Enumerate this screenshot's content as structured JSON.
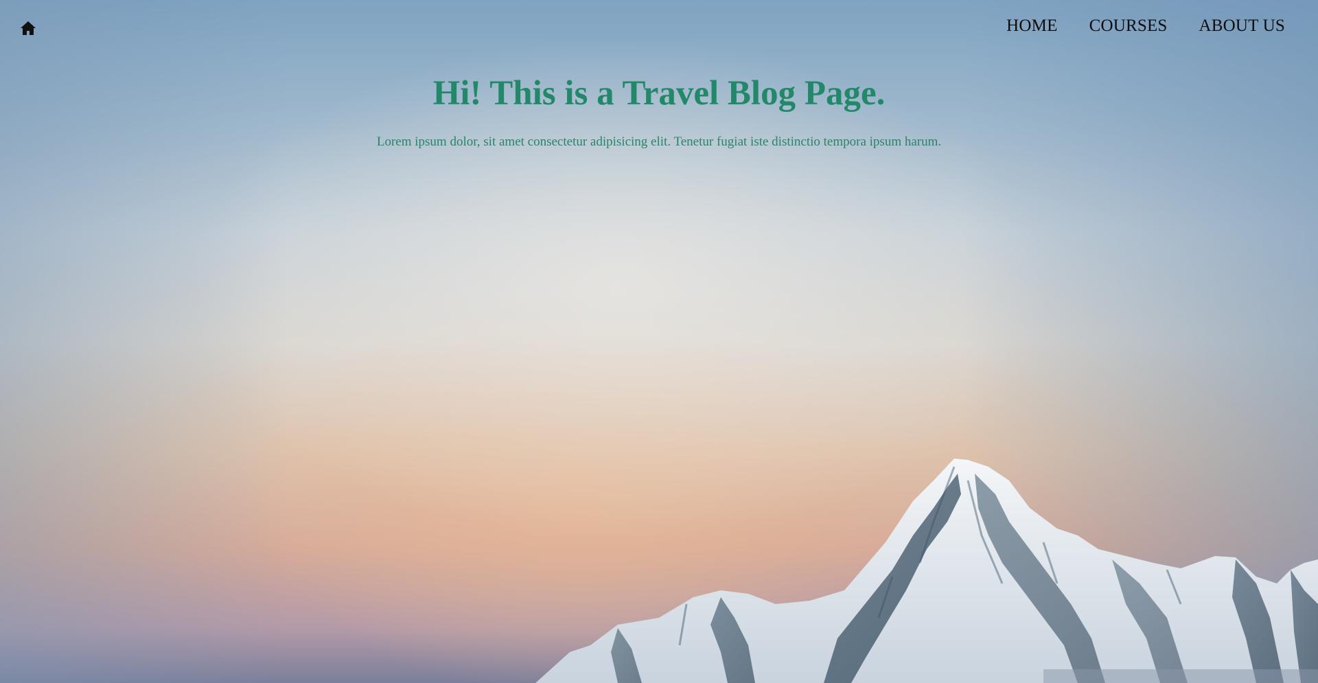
{
  "navbar": {
    "home_icon": "home-icon",
    "links": [
      {
        "label": "HOME"
      },
      {
        "label": "COURSES"
      },
      {
        "label": "ABOUT US"
      }
    ]
  },
  "hero": {
    "title": "Hi! This is a Travel Blog Page.",
    "text": "Lorem ipsum dolor, sit amet consectetur adipisicing elit. Tenetur fugiat iste distinctio tempora ipsum harum."
  },
  "colors": {
    "heading": "#23886a",
    "nav_text": "#0d0d0d"
  }
}
